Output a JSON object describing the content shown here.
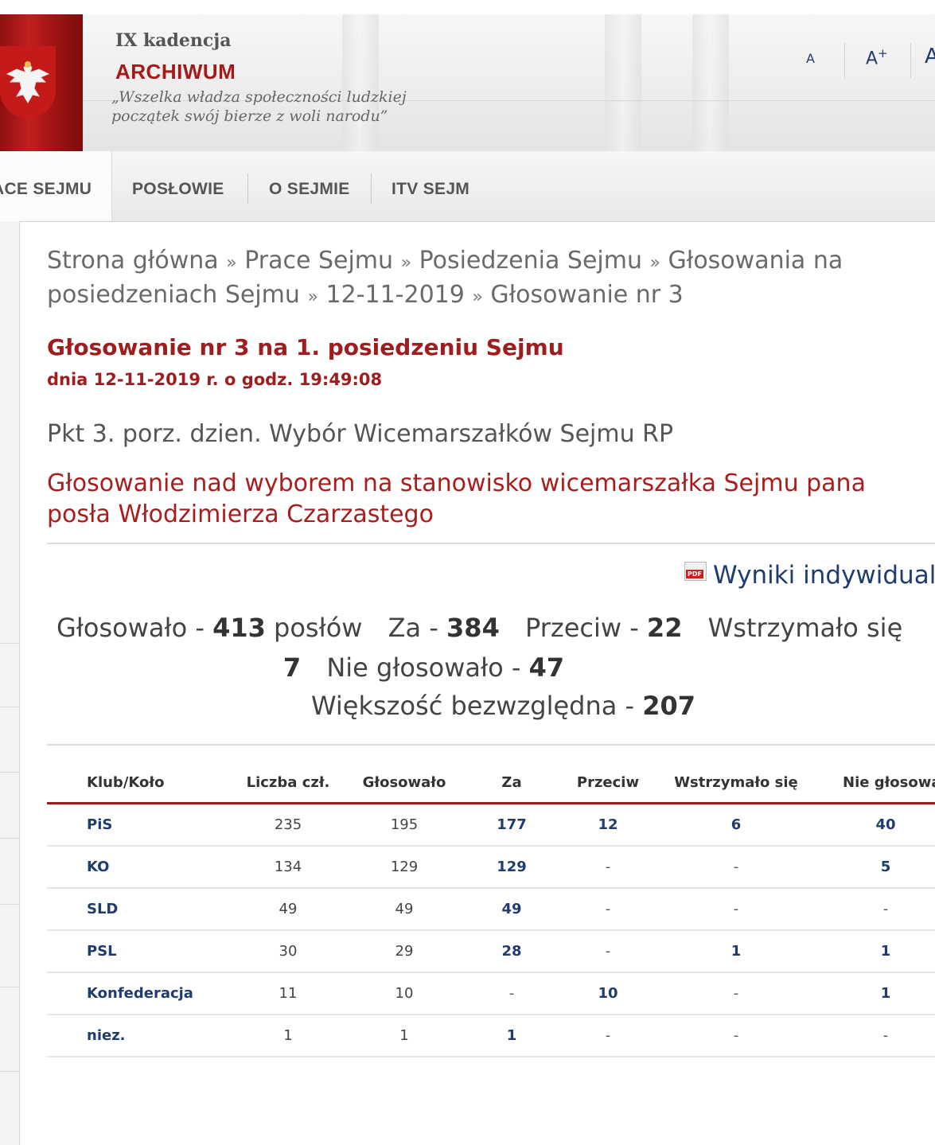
{
  "header": {
    "term": "IX kadencja",
    "archive": "ARCHIWUM",
    "motto_line1": "„Wszelka władza społeczności ludzkiej",
    "motto_line2": "początek swój bierze z woli narodu”",
    "font_small": "A",
    "font_medium": "A+",
    "font_large": "A"
  },
  "nav": {
    "items": [
      "ACE SEJMU",
      "POSŁOWIE",
      "O SEJMIE",
      "ITV SEJM"
    ]
  },
  "breadcrumb": {
    "items": [
      "Strona główna",
      "Prace Sejmu",
      "Posiedzenia Sejmu",
      "Głosowania na posiedzeniach Sejmu",
      "12-11-2019",
      "Głosowanie nr 3"
    ],
    "separator": "»"
  },
  "vote": {
    "title": "Głosowanie nr 3 na 1. posiedzeniu Sejmu",
    "date": "dnia 12-11-2019 r. o godz. 19:49:08",
    "agenda": "Pkt 3. porz. dzien. Wybór Wicemarszałków Sejmu RP",
    "subject": "Głosowanie nad wyborem na stanowisko wicemarszałka Sejmu pana posła Włodzimierza Czarzastego",
    "individual_results_link": "Wyniki indywidual",
    "pdf_icon_text": "PDF"
  },
  "summary": {
    "voted_label": "Głosowało -",
    "voted_value": "413",
    "voted_unit": "posłów",
    "for_label": "Za -",
    "for_value": "384",
    "against_label": "Przeciw -",
    "against_value": "22",
    "abstained_label": "Wstrzymało się",
    "abstained_value": "7",
    "not_voted_label": "Nie głosowało -",
    "not_voted_value": "47",
    "majority_label": "Większość bezwzględna -",
    "majority_value": "207"
  },
  "table": {
    "headers": [
      "Klub/Koło",
      "Liczba czł.",
      "Głosowało",
      "Za",
      "Przeciw",
      "Wstrzymało się",
      "Nie głosowa"
    ],
    "rows": [
      [
        "PiS",
        "235",
        "195",
        "177",
        "12",
        "6",
        "40"
      ],
      [
        "KO",
        "134",
        "129",
        "129",
        "-",
        "-",
        "5"
      ],
      [
        "SLD",
        "49",
        "49",
        "49",
        "-",
        "-",
        "-"
      ],
      [
        "PSL",
        "30",
        "29",
        "28",
        "-",
        "1",
        "1"
      ],
      [
        "Konfederacja",
        "11",
        "10",
        "-",
        "10",
        "-",
        "1"
      ],
      [
        "niez.",
        "1",
        "1",
        "1",
        "-",
        "-",
        "-"
      ]
    ]
  },
  "colors": {
    "accent_red": "#a31a1a",
    "link_blue": "#1f3c6e"
  }
}
